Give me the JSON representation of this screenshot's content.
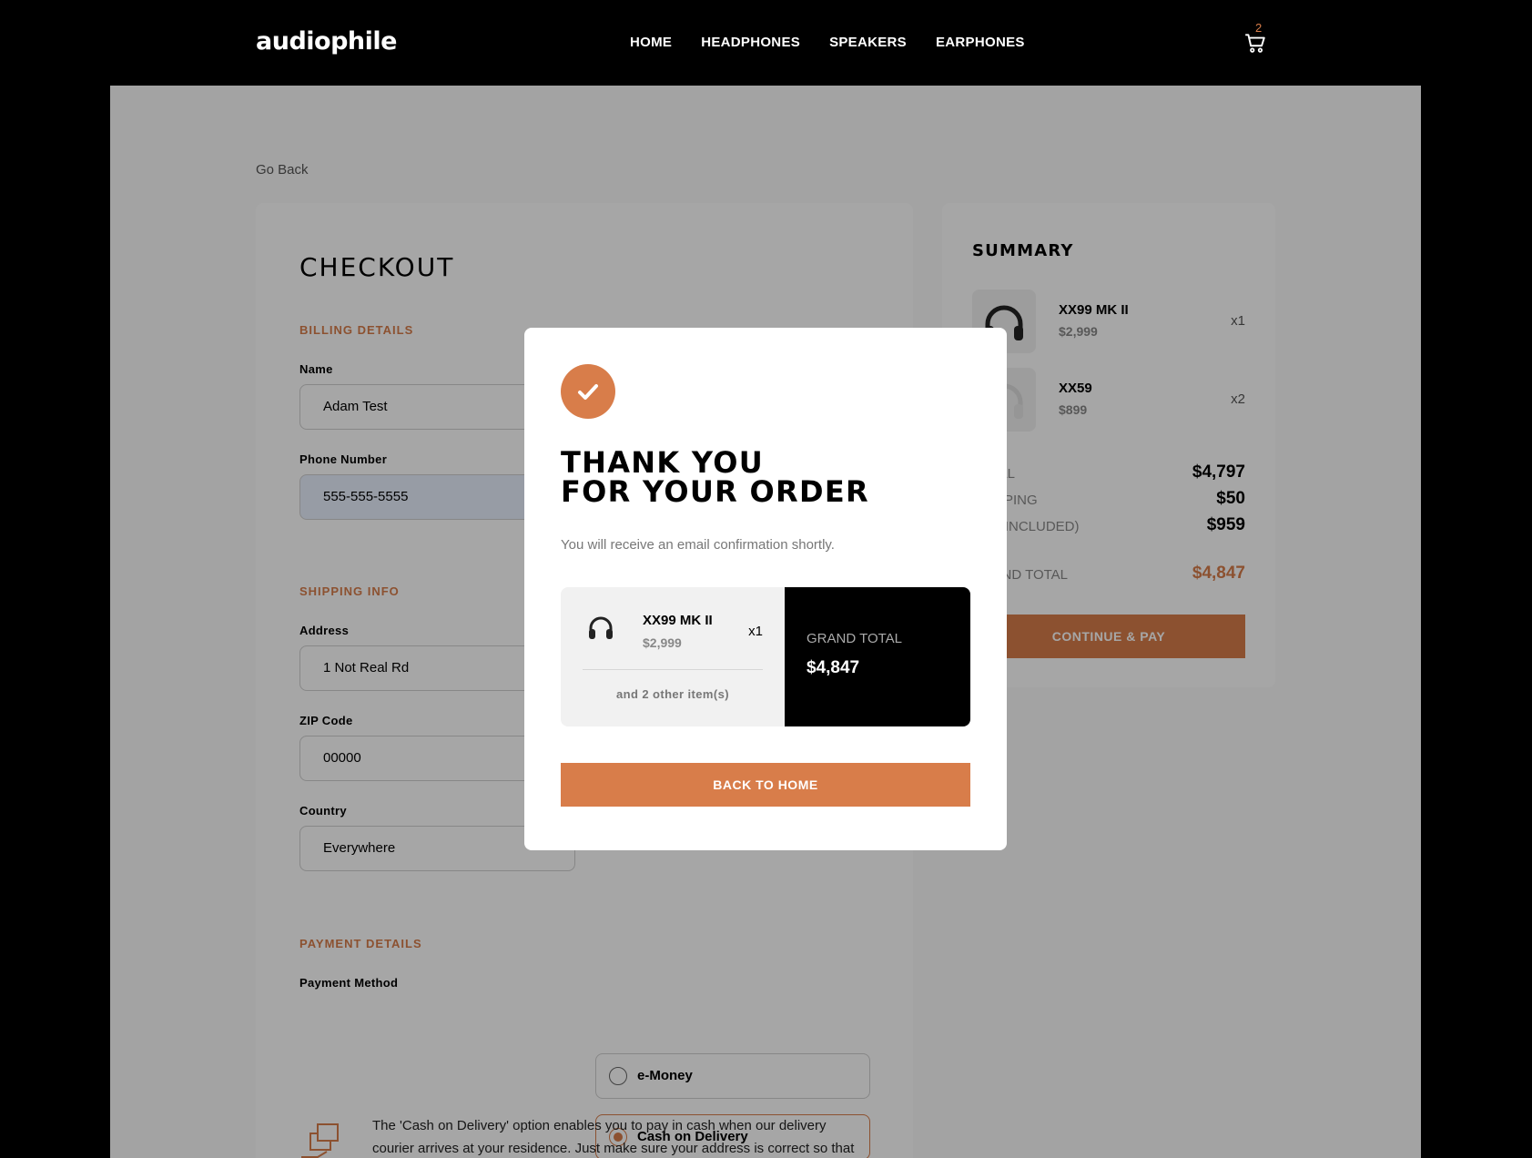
{
  "header": {
    "logo": "audiophile",
    "nav": [
      "HOME",
      "HEADPHONES",
      "SPEAKERS",
      "EARPHONES"
    ],
    "cart_count": "2",
    "cart_icon": "cart-icon"
  },
  "page": {
    "go_back": "Go Back"
  },
  "checkout": {
    "title": "CHECKOUT",
    "billing_label": "BILLING DETAILS",
    "name_label": "Name",
    "name_value": "Adam Test",
    "phone_label": "Phone Number",
    "phone_value": "555-555-5555",
    "shipping_label": "SHIPPING INFO",
    "address_label": "Address",
    "address_value": "1 Not Real Rd",
    "zip_label": "ZIP Code",
    "zip_value": "00000",
    "country_label": "Country",
    "country_value": "Everywhere",
    "payment_label": "PAYMENT DETAILS",
    "payment_method_label": "Payment Method",
    "payment_options": [
      "e-Money",
      "Cash on Delivery"
    ],
    "payment_selected": "Cash on Delivery",
    "cod_text": "The 'Cash on Delivery' option enables you to pay in cash when our delivery courier arrives at your residence. Just make sure your address is correct so that your order will not be cancelled."
  },
  "summary": {
    "title": "SUMMARY",
    "items": [
      {
        "name": "XX99 MK II",
        "price": "$2,999",
        "qty": "x1"
      },
      {
        "name": "XX59",
        "price": "$899",
        "qty": "x2"
      }
    ],
    "total_label": "TOTAL",
    "total_value": "$4,797",
    "shipping_label": "SHIPPING",
    "shipping_value": "$50",
    "vat_label": "VAT (INCLUDED)",
    "vat_value": "$959",
    "grand_label": "GRAND TOTAL",
    "grand_value": "$4,847",
    "continue_label": "CONTINUE & PAY"
  },
  "modal": {
    "title_line1": "THANK YOU",
    "title_line2": "FOR YOUR ORDER",
    "subtitle": "You will receive an email confirmation shortly.",
    "item_name": "XX99 MK II",
    "item_price": "$2,999",
    "item_qty": "x1",
    "others": "and 2 other item(s)",
    "grand_label": "GRAND TOTAL",
    "grand_value": "$4,847",
    "button": "BACK TO HOME"
  },
  "colors": {
    "accent": "#d87d4a",
    "black": "#000000",
    "light_gray": "#f1f1f1"
  }
}
